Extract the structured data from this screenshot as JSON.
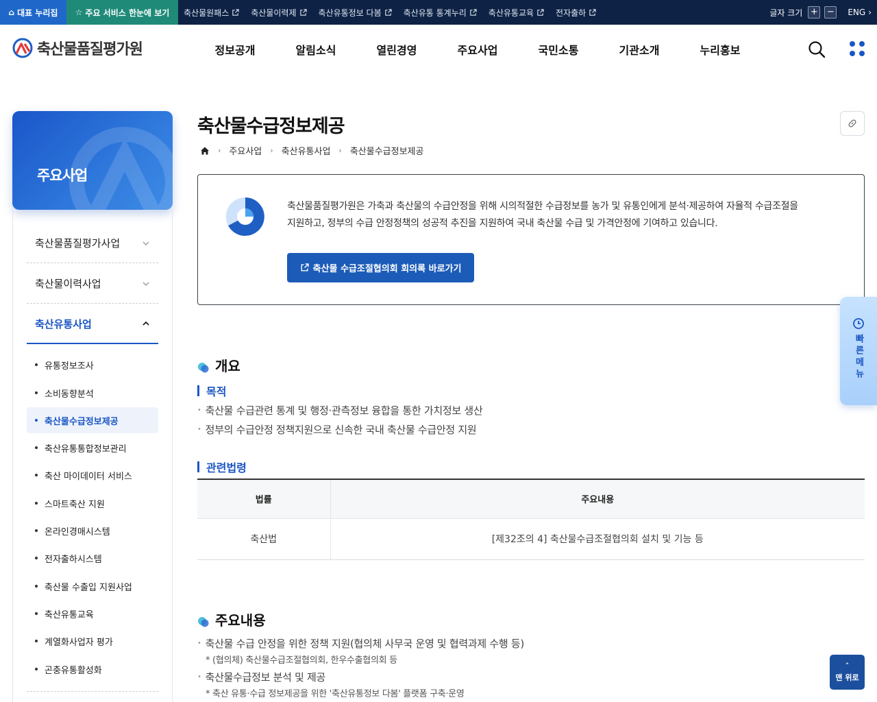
{
  "topbar": {
    "home_label": "대표 누리집",
    "star_label": "주요 서비스 한눈에 보기",
    "links": [
      "축산물원패스",
      "축산물이력제",
      "축산유통정보 다봄",
      "축산유통 통계누리",
      "축산유통교육",
      "전자출하"
    ],
    "font_size_label": "글자 크기",
    "plus": "+",
    "minus": "−",
    "lang": "ENG"
  },
  "header": {
    "logo_text": "축산물품질평가원",
    "gnb": [
      "정보공개",
      "알림소식",
      "열린경영",
      "주요사업",
      "국민소통",
      "기관소개",
      "누리홍보"
    ]
  },
  "sidebar": {
    "hero_title": "주요사업",
    "categories": [
      "축산물품질평가사업",
      "축산물이력사업",
      "축산유통사업"
    ],
    "subitems": [
      "유통정보조사",
      "소비동향분석",
      "축산물수급정보제공",
      "축산유통통합정보관리",
      "축산 마이데이터 서비스",
      "스마트축산 지원",
      "온라인경매시스템",
      "전자출하시스템",
      "축산물 수출입 지원사업",
      "축산유통교육",
      "계열화사업자 평가",
      "곤충유통활성화"
    ]
  },
  "main": {
    "page_title": "축산물수급정보제공",
    "breadcrumb": [
      "주요사업",
      "축산유통사업",
      "축산물수급정보제공"
    ],
    "intro_line1": "축산물품질평가원은 가축과 축산물의 수급안정을 위해 시의적절한 수급정보를 농가 및 유통인에게 분석·제공하여 자율적 수급조절을",
    "intro_line2": "지원하고, 정부의 수급 안정정책의 성공적 추진을 지원하여 국내 축산물 수급 및 가격안정에 기여하고 있습니다.",
    "intro_button": "축산물 수급조절협의회 회의록 바로가기",
    "overview_heading": "개요",
    "purpose_heading": "목적",
    "purpose_items": [
      "축산물 수급관련 통계 및 행정·관측정보 융합을 통한 가치정보 생산",
      "정부의 수급안정 정책지원으로 신속한 국내 축산물 수급안정 지원"
    ],
    "law_heading": "관련법령",
    "law_table": {
      "headers": [
        "법률",
        "주요내용"
      ],
      "rows": [
        [
          "축산법",
          "[제32조의 4] 축산물수급조절협의회 설치 및 기능 등"
        ]
      ]
    },
    "content_heading": "주요내용",
    "content_item1": "축산물 수급 안정을 위한 정책 지원(협의체 사무국 운영 및 협력과제 수행 등)",
    "content_note1": "* (협의체) 축산물수급조절협의회, 한우수출협의회 등",
    "content_item2": "축산물수급정보 분석 및 제공",
    "content_note2": "* 축산 유통·수급 정보제공을 위한 '축산유통정보 다봄' 플랫폼 구축·운영"
  },
  "quick_menu": {
    "label": "빠른메뉴"
  },
  "top_button": {
    "label": "맨 위로"
  },
  "colors": {
    "accent": "#1a56c4",
    "topbar": "#0e2245",
    "star": "#1f8a78",
    "home": "#1f68c9"
  }
}
